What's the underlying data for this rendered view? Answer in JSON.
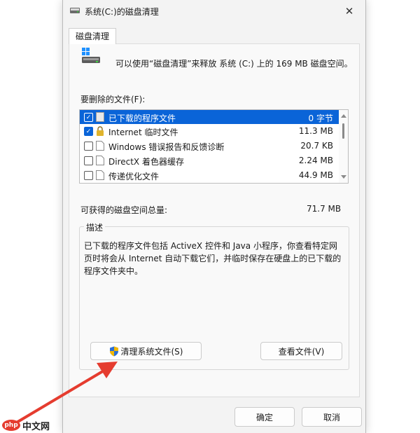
{
  "window": {
    "title": "系统(C:)的磁盘清理",
    "close_glyph": "✕"
  },
  "tab": {
    "label": "磁盘清理"
  },
  "info": {
    "text": "可以使用“磁盘清理”来释放 系统 (C:) 上的 169 MB 磁盘空间。"
  },
  "files": {
    "label": "要删除的文件(F):",
    "items": [
      {
        "name": "已下载的程序文件",
        "size": "0 字节",
        "checked": true,
        "selected": true
      },
      {
        "name": "Internet 临时文件",
        "size": "11.3 MB",
        "checked": true,
        "selected": false
      },
      {
        "name": "Windows 错误报告和反馈诊断",
        "size": "20.7 KB",
        "checked": false,
        "selected": false
      },
      {
        "name": "DirectX 着色器缓存",
        "size": "2.24 MB",
        "checked": false,
        "selected": false
      },
      {
        "name": "传递优化文件",
        "size": "44.9 MB",
        "checked": false,
        "selected": false
      }
    ]
  },
  "total": {
    "label": "可获得的磁盘空间总量:",
    "value": "71.7 MB"
  },
  "description": {
    "title": "描述",
    "text": "已下载的程序文件包括 ActiveX 控件和 Java 小程序，你查看特定网页时将会从 Internet 自动下载它们，并临时保存在硬盘上的已下载的程序文件夹中。"
  },
  "buttons": {
    "cleanup_system": "清理系统文件(S)",
    "view_files": "查看文件(V)",
    "ok": "确定",
    "cancel": "取消"
  },
  "watermark": {
    "badge": "php",
    "text": "中文网"
  },
  "colors": {
    "accent": "#0a64d8",
    "arrow": "#e53c2f"
  }
}
